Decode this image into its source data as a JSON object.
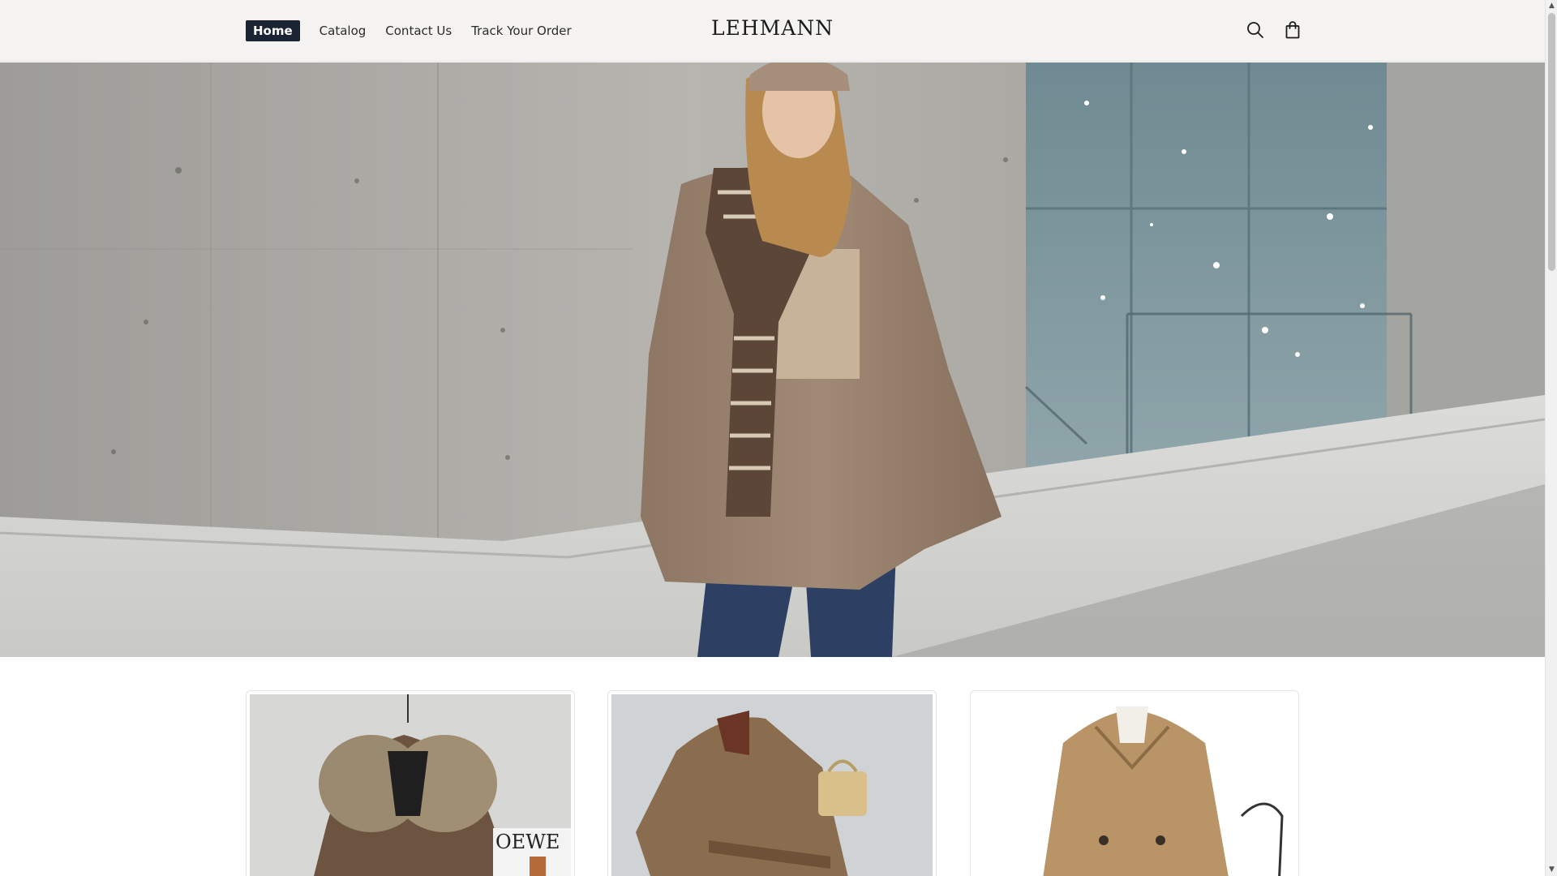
{
  "header": {
    "nav": [
      {
        "label": "Home",
        "active": true
      },
      {
        "label": "Catalog",
        "active": false
      },
      {
        "label": "Contact Us",
        "active": false
      },
      {
        "label": "Track Your Order",
        "active": false
      }
    ],
    "logo": "LEHMANN",
    "icons": [
      "search-icon",
      "shopping-bag-icon"
    ]
  },
  "hero": {
    "image": "woman-in-puffer-jacket-snowy-street"
  },
  "products": [
    {
      "image": "fur-collar-down-jacket",
      "brand_sign": "OEWE"
    },
    {
      "image": "wool-wrap-coat-with-handbag"
    },
    {
      "image": "beige-trench-coat"
    }
  ],
  "scrollbar": {
    "up_arrow": "▲",
    "down_arrow": "▼",
    "position": 0.0
  },
  "colors": {
    "header_bg": "#f4f3f1",
    "active_nav_bg": "#1b2433",
    "text": "#2b2b2b"
  }
}
